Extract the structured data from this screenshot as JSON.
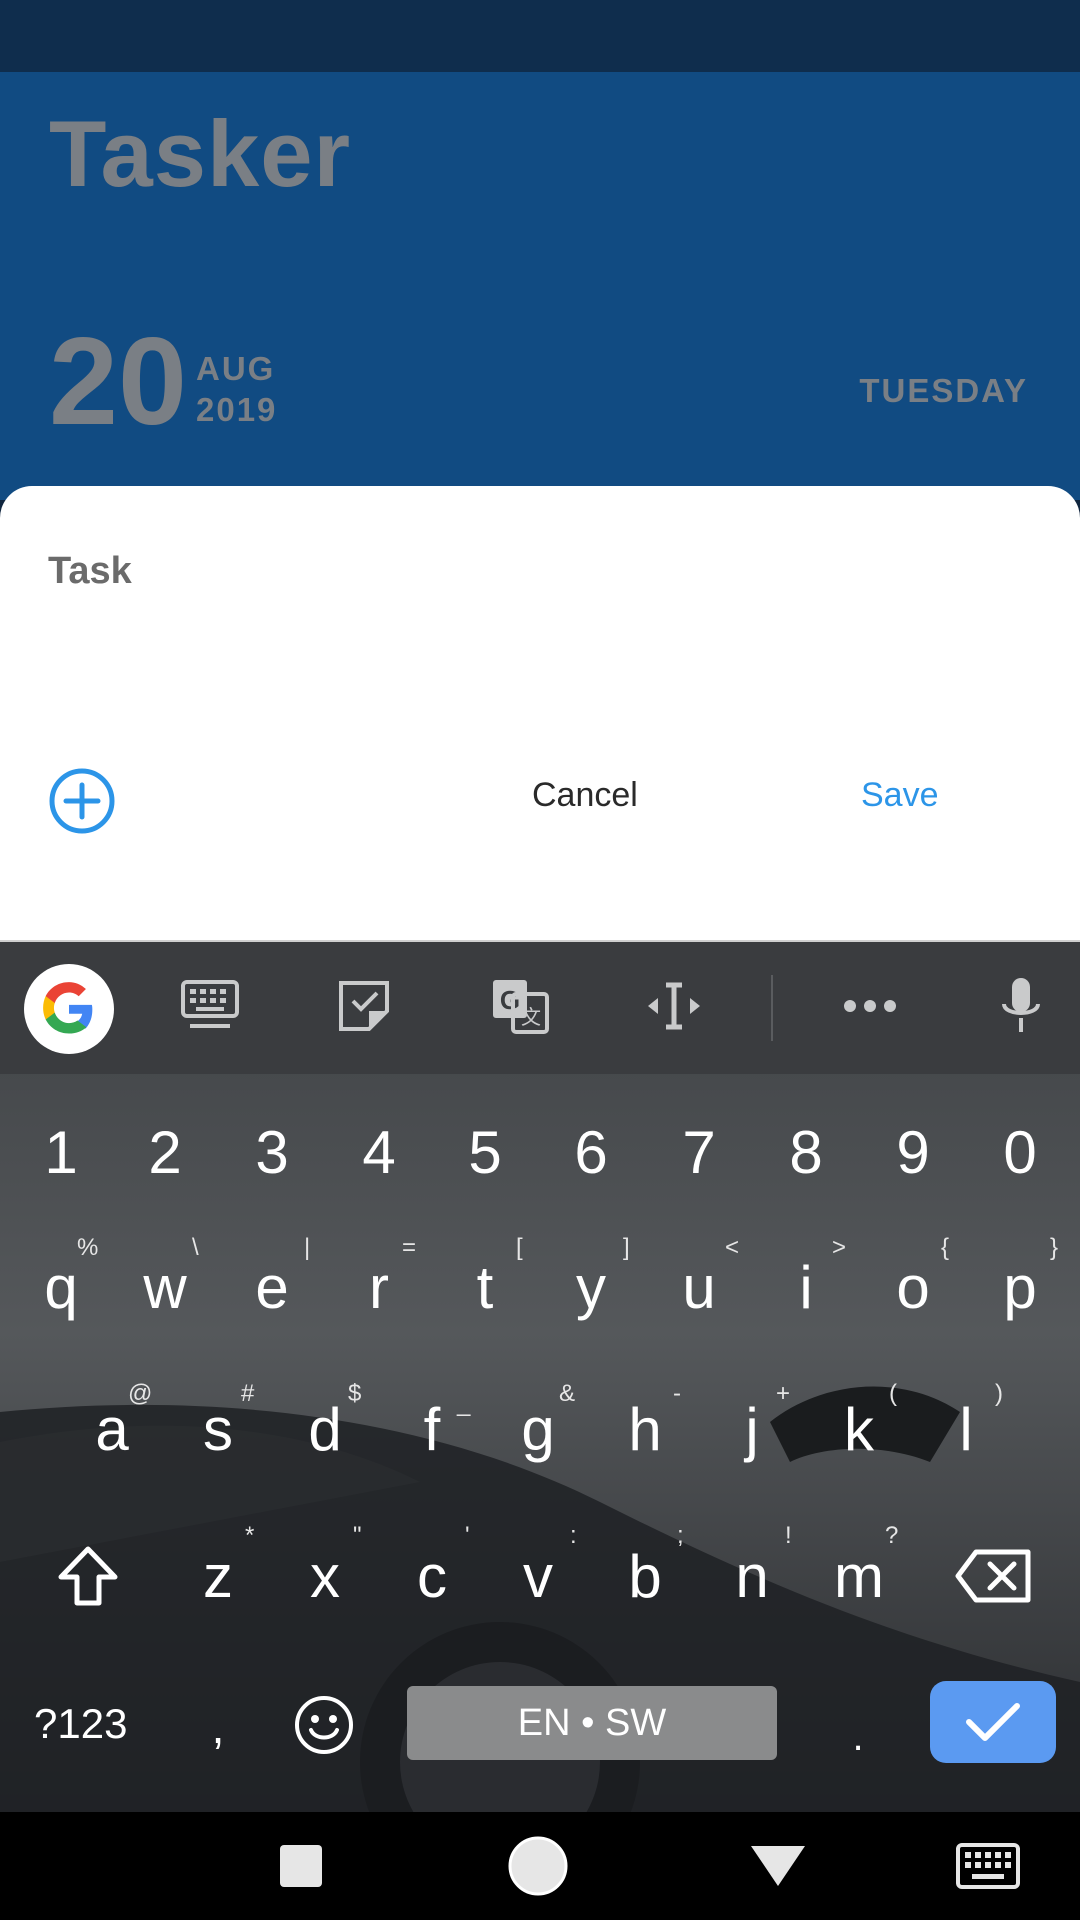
{
  "app": {
    "title": "Tasker",
    "date_day": "20",
    "date_month": "AUG",
    "date_year": "2019",
    "weekday": "TUESDAY"
  },
  "dialog": {
    "task_label": "Task",
    "cancel_label": "Cancel",
    "save_label": "Save"
  },
  "keyboard": {
    "number_row": [
      "1",
      "2",
      "3",
      "4",
      "5",
      "6",
      "7",
      "8",
      "9",
      "0"
    ],
    "row1": [
      "q",
      "w",
      "e",
      "r",
      "t",
      "y",
      "u",
      "i",
      "o",
      "p"
    ],
    "row1_hints": [
      "%",
      "\\",
      "|",
      "=",
      "[",
      "]",
      "<",
      ">",
      "{",
      "}"
    ],
    "row2": [
      "a",
      "s",
      "d",
      "f",
      "g",
      "h",
      "j",
      "k",
      "l"
    ],
    "row2_hints": [
      "@",
      "#",
      "$",
      "_",
      "&",
      "-",
      "+",
      "(",
      ")"
    ],
    "row3": [
      "z",
      "x",
      "c",
      "v",
      "b",
      "n",
      "m"
    ],
    "row3_hints": [
      "*",
      "\"",
      "'",
      ":",
      ";",
      "!",
      "?"
    ],
    "symbols_label": "?123",
    "comma_label": ",",
    "period_label": ".",
    "space_label": "EN • SW"
  },
  "colors": {
    "accent": "#2c95e8",
    "header": "#114b82",
    "enter": "#5b9af1"
  }
}
